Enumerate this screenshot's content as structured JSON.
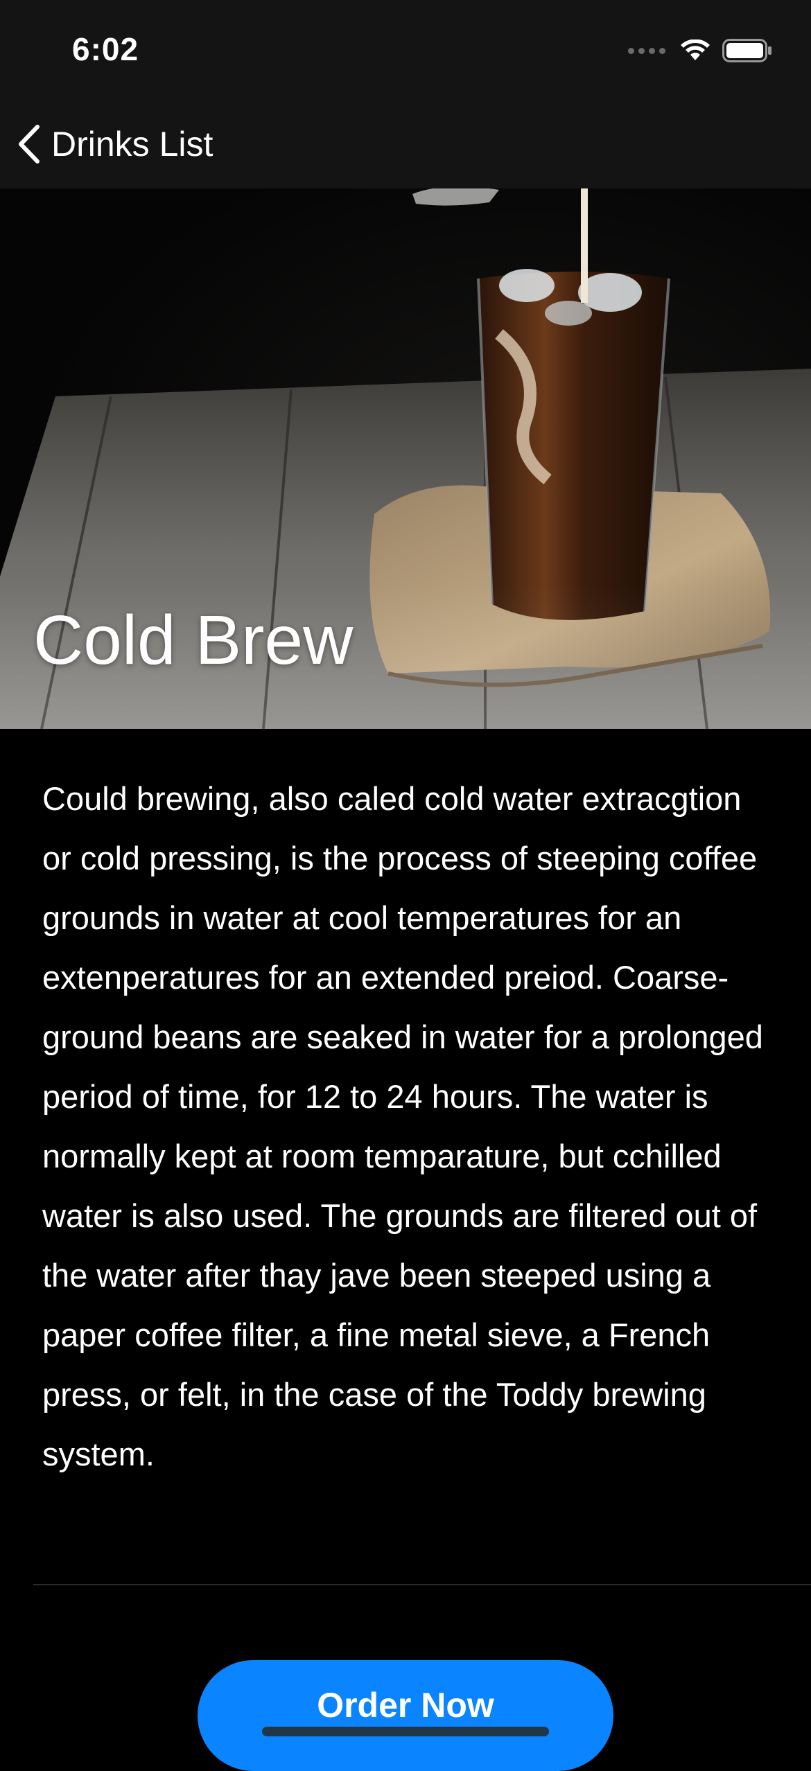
{
  "status_bar": {
    "time": "6:02",
    "icons": [
      "cellular-signal-icon",
      "wifi-icon",
      "battery-icon"
    ]
  },
  "nav": {
    "back_label": "Drinks List",
    "back_icon": "chevron-left-icon"
  },
  "drink": {
    "title": "Cold Brew",
    "image": "iced-coffee-photo",
    "description": "Could brewing, also caled cold water extracgtion or cold pressing, is the process of steeping coffee grounds in water at cool temperatures for an extenperatures for an extended preiod. Coarse-ground beans are seaked in water for a prolonged period of time, for 12 to 24 hours. The water is normally kept at room temparature, but cchilled water is also used. The grounds are filtered out of the water after thay jave been steeped using a paper coffee filter, a fine metal sieve, a French press, or felt, in the case of the Toddy brewing system."
  },
  "actions": {
    "order_label": "Order Now"
  },
  "colors": {
    "background": "#000000",
    "bar_background": "#141414",
    "accent": "#0a84ff",
    "text": "#ffffff"
  }
}
